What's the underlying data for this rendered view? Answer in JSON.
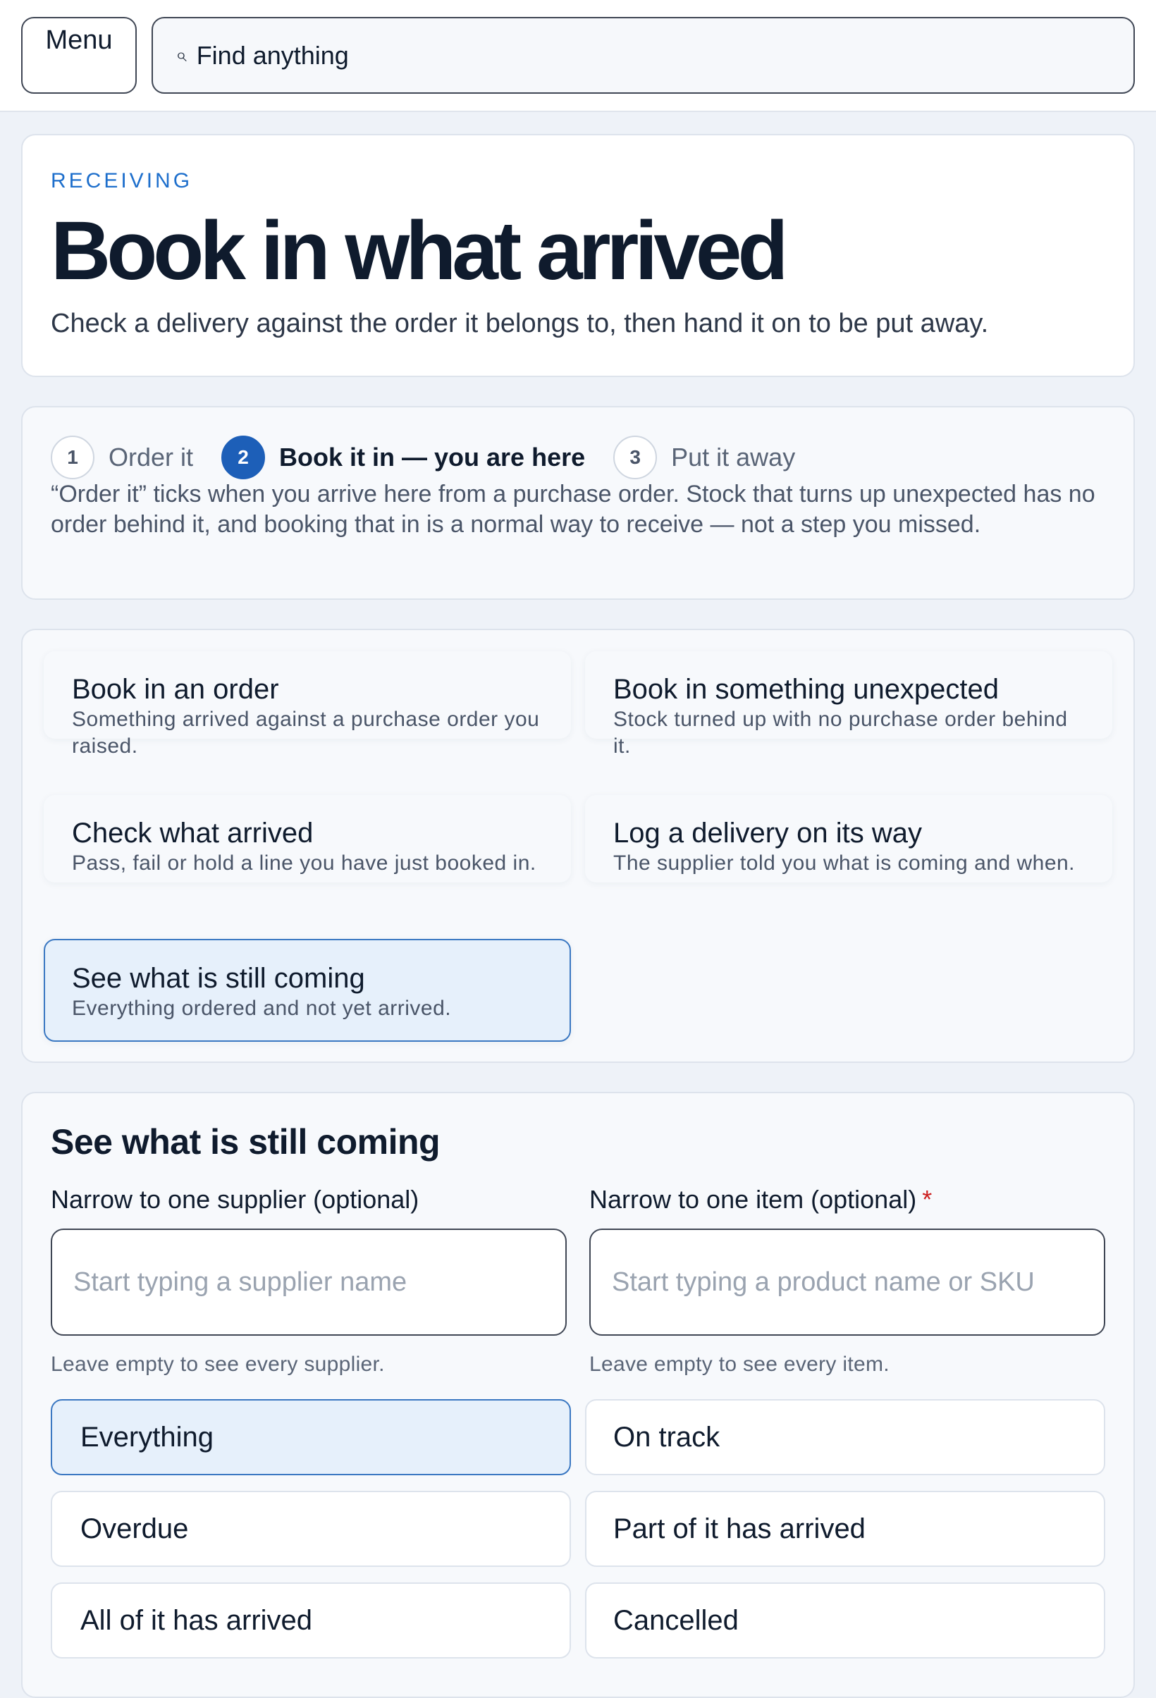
{
  "topbar": {
    "menu_label": "Menu",
    "search_icon": "search-icon",
    "search_label": "Find anything"
  },
  "hero": {
    "eyebrow": "RECEIVING",
    "title": "Book in what arrived",
    "subtitle": "Check a delivery against the order it belongs to, then hand it on to be put away."
  },
  "steps": {
    "items": [
      {
        "number": "1",
        "label": "Order it",
        "state": "done"
      },
      {
        "number": "2",
        "label": "Book it in — you are here",
        "state": "current"
      },
      {
        "number": "3",
        "label": "Put it away",
        "state": "upcoming"
      }
    ],
    "note": "“Order it” ticks when you arrive here from a purchase order. Stock that turns up unexpected has no order behind it, and booking that in is a normal way to receive — not a step you missed."
  },
  "options": [
    {
      "title": "Book in an order",
      "description": "Something arrived against a purchase order you raised."
    },
    {
      "title": "Book in something unexpected",
      "description": "Stock turned up with no purchase order behind it."
    },
    {
      "title": "Check what arrived",
      "description": "Pass, fail or hold a line you have just booked in."
    },
    {
      "title": "Log a delivery on its way",
      "description": "The supplier told you what is coming and when."
    },
    {
      "title": "See what is still coming",
      "description": "Everything ordered and not yet arrived.",
      "selected": true
    }
  ],
  "filter": {
    "title": "See what is still coming",
    "supplier": {
      "label": "Narrow to one supplier (optional)",
      "placeholder": "Start typing a supplier name",
      "hint": "Leave empty to see every supplier."
    },
    "item": {
      "label": "Narrow to one item (optional)",
      "required_mark": "*",
      "placeholder": "Start typing a product name or SKU",
      "hint": "Leave empty to see every item."
    },
    "statuses": [
      {
        "label": "Everything",
        "selected": true
      },
      {
        "label": "On track"
      },
      {
        "label": "Overdue"
      },
      {
        "label": "Part of it has arrived"
      },
      {
        "label": "All of it has arrived"
      },
      {
        "label": "Cancelled"
      }
    ]
  },
  "colors": {
    "accent": "#1d5fb8",
    "eyebrow": "#1e6fcc",
    "selected_bg": "#e6f0fb",
    "required": "#cc1f1f"
  }
}
